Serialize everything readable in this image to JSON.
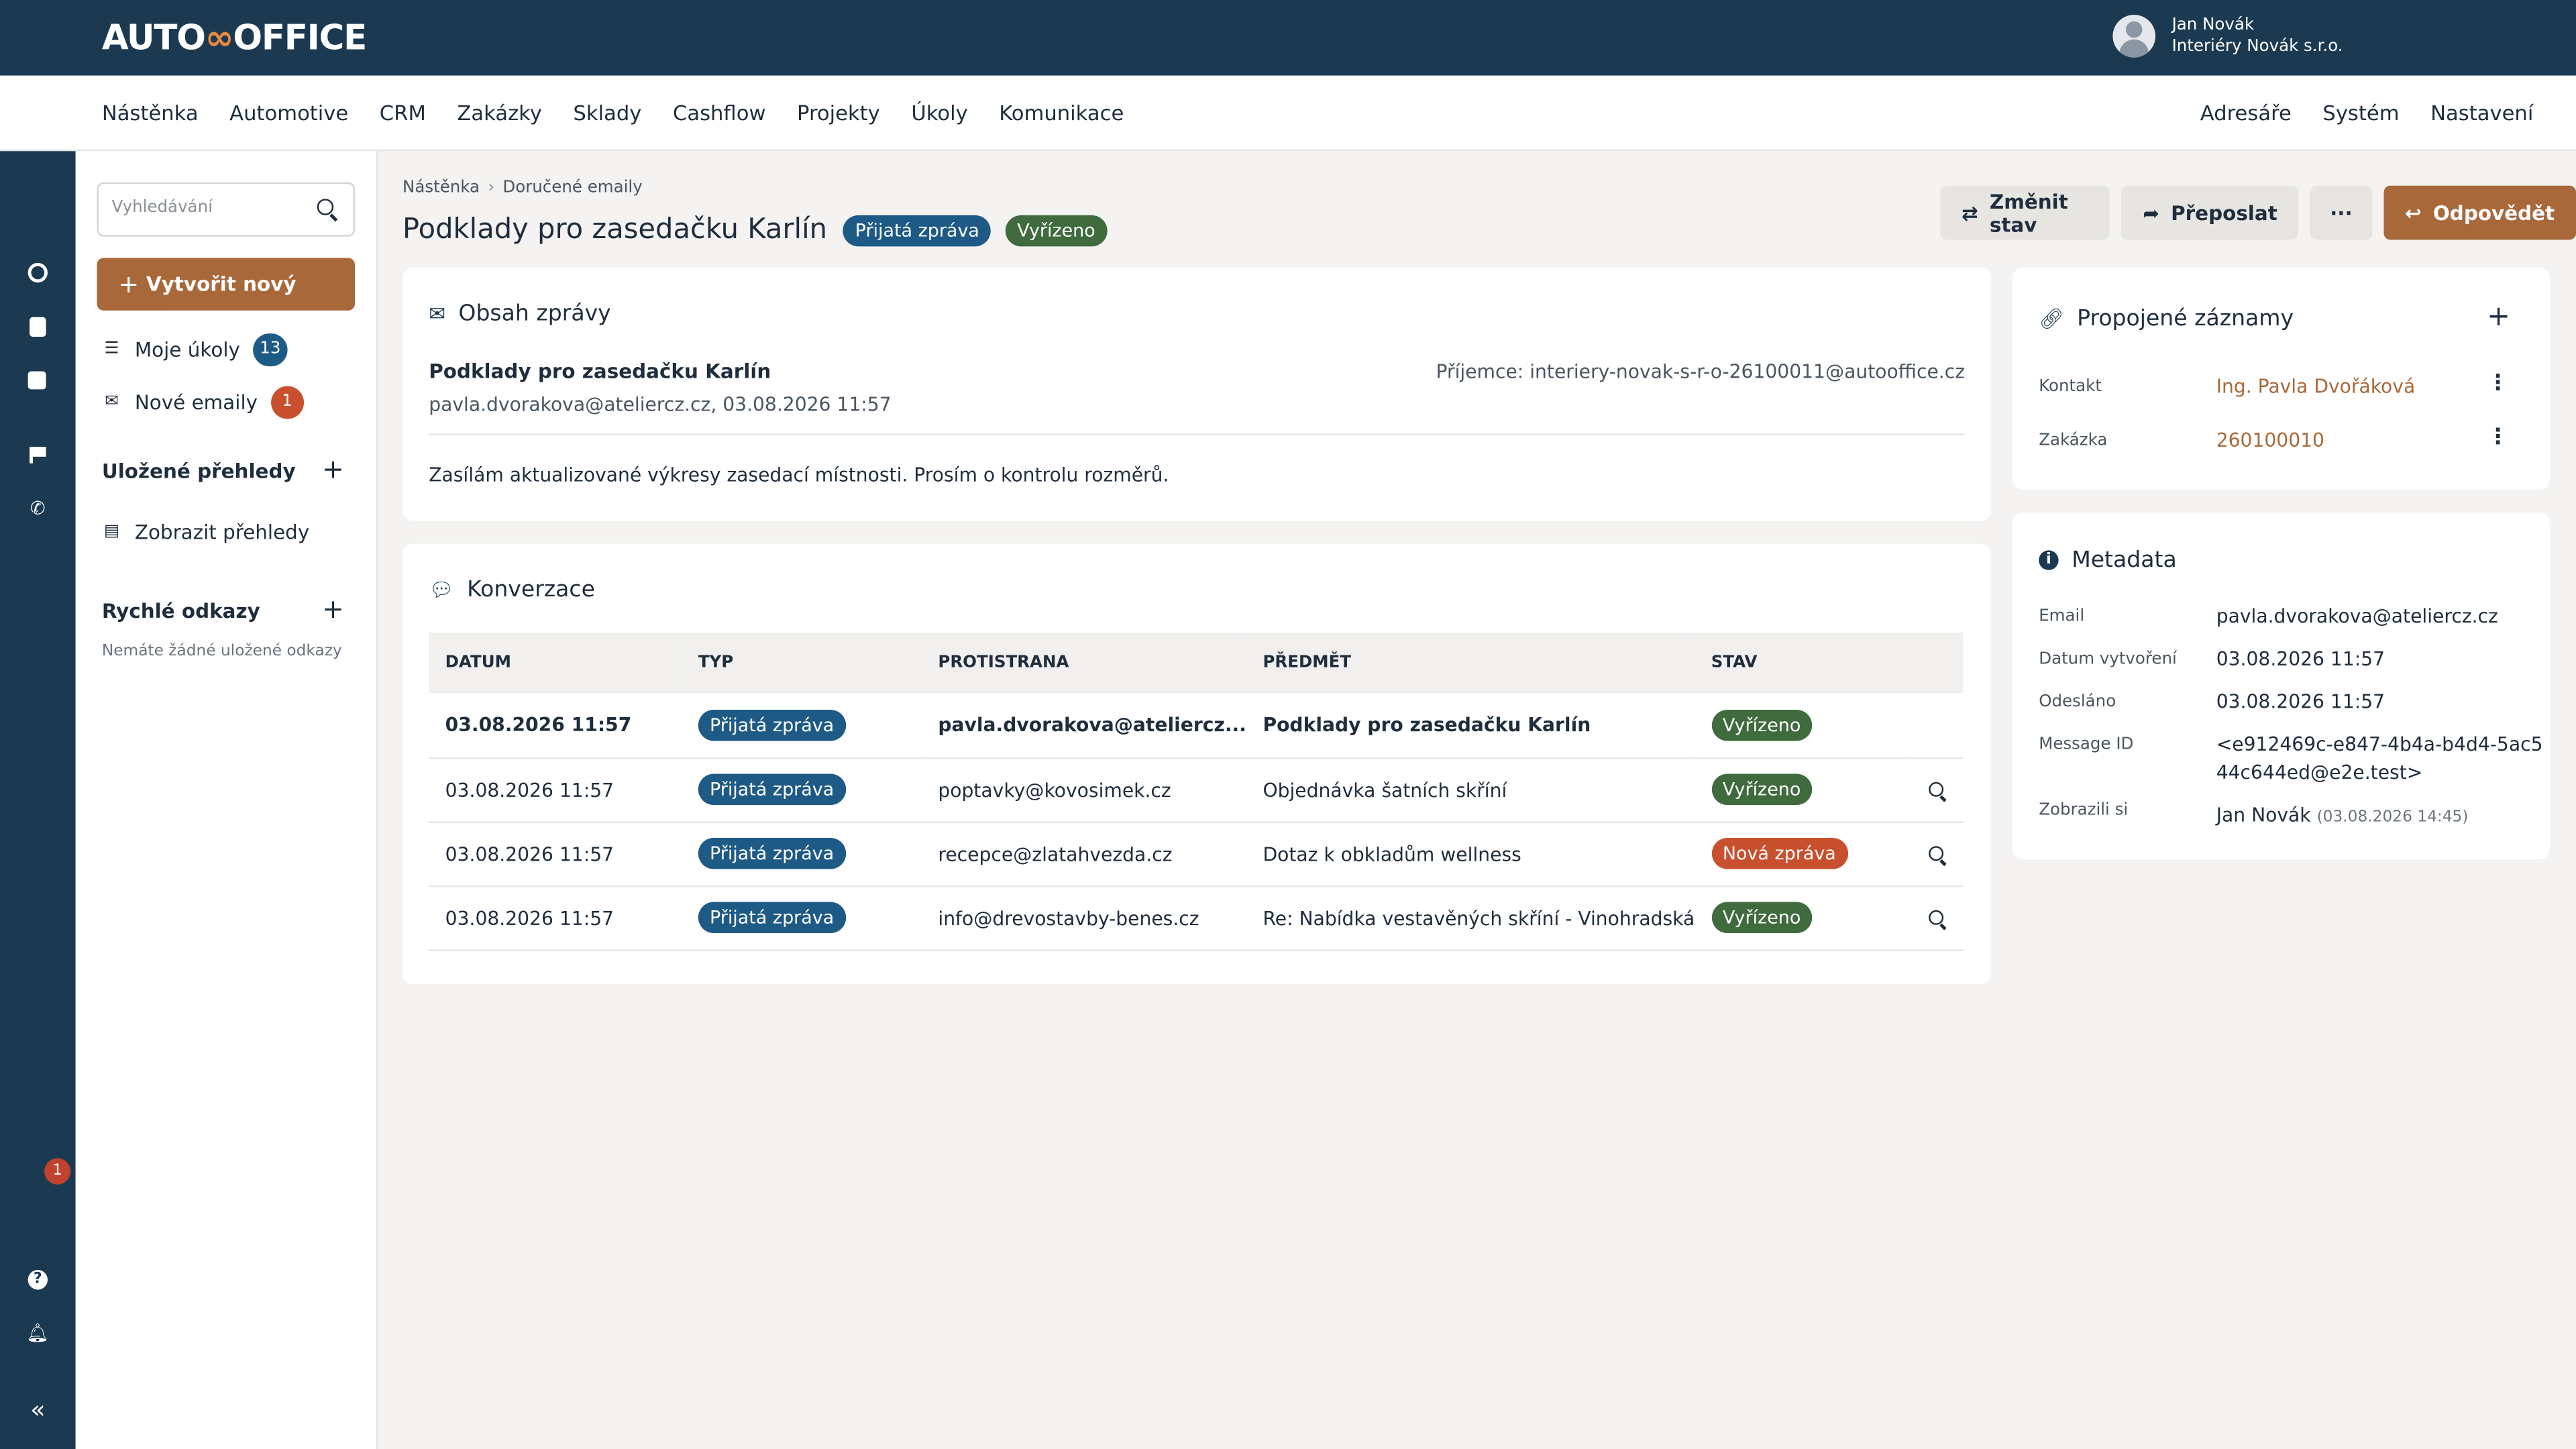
{
  "app": {
    "logo_a": "AUTO",
    "logo_b": "OFFICE",
    "user_name": "Jan Novák",
    "user_company": "Interiéry Novák s.r.o."
  },
  "nav": {
    "left": [
      "Nástěnka",
      "Automotive",
      "CRM",
      "Zakázky",
      "Sklady",
      "Cashflow",
      "Projekty",
      "Úkoly",
      "Komunikace"
    ],
    "right": [
      "Adresáře",
      "Systém",
      "Nastavení"
    ]
  },
  "rail": {
    "icons": [
      "clock-icon",
      "calculator-icon",
      "calendar-icon",
      "flag-icon",
      "phone-icon",
      "help-icon",
      "bell-icon",
      "collapse-icon"
    ],
    "notifications": "1"
  },
  "sidebar": {
    "search_placeholder": "Vyhledávání",
    "create_label": "Vytvořit nový",
    "my_tasks": "Moje úkoly",
    "my_tasks_count": "13",
    "new_emails": "Nové emaily",
    "new_emails_count": "1",
    "saved_views": "Uložené přehledy",
    "show_views": "Zobrazit přehledy",
    "quick_links": "Rychlé odkazy",
    "no_links": "Nemáte žádné uložené odkazy"
  },
  "breadcrumb": [
    "Nástěnka",
    "Doručené emaily"
  ],
  "page": {
    "title": "Podklady pro zasedačku Karlín",
    "type_badge": "Přijatá zpráva",
    "status_badge": "Vyřízeno"
  },
  "actions": {
    "change_status": "Změnit stav",
    "forward": "Přeposlat",
    "more": "···",
    "reply": "Odpovědět"
  },
  "message": {
    "card_title": "Obsah zprávy",
    "subject": "Podklady pro zasedačku Karlín",
    "from_line": "pavla.dvorakova@ateliercz.cz, 03.08.2026 11:57",
    "recipient": "Příjemce: interiery-novak-s-r-o-26100011@autooffice.cz",
    "body": "Zasílám aktualizované výkresy zasedací místnosti. Prosím o kontrolu rozměrů."
  },
  "conversation": {
    "title": "Konverzace",
    "headers": [
      "DATUM",
      "TYP",
      "PROTISTRANA",
      "PŘEDMĚT",
      "STAV"
    ],
    "rows": [
      {
        "date": "03.08.2026 11:57",
        "type": "Přijatá zpráva",
        "party": "pavla.dvorakova@ateliercz...",
        "subject": "Podklady pro zasedačku Karlín",
        "status": "Vyřízeno",
        "status_color": "#3f6b3f"
      },
      {
        "date": "03.08.2026 11:57",
        "type": "Přijatá zpráva",
        "party": "poptavky@kovosimek.cz",
        "subject": "Objednávka šatních skříní",
        "status": "Vyřízeno",
        "status_color": "#3f6b3f"
      },
      {
        "date": "03.08.2026 11:57",
        "type": "Přijatá zpráva",
        "party": "recepce@zlatahvezda.cz",
        "subject": "Dotaz k obkladům wellness",
        "status": "Nová zpráva",
        "status_color": "#c8502e"
      },
      {
        "date": "03.08.2026 11:57",
        "type": "Přijatá zpráva",
        "party": "info@drevostavby-benes.cz",
        "subject": "Re: Nabídka vestavěných skříní - Vinohradská",
        "status": "Vyřízeno",
        "status_color": "#3f6b3f"
      }
    ]
  },
  "linked": {
    "title": "Propojené záznamy",
    "contact_label": "Kontakt",
    "contact_value": "Ing. Pavla Dvořáková",
    "order_label": "Zakázka",
    "order_value": "260100010"
  },
  "metadata": {
    "title": "Metadata",
    "email_label": "Email",
    "email_value": "pavla.dvorakova@ateliercz.cz",
    "created_label": "Datum vytvoření",
    "created_value": "03.08.2026 11:57",
    "sent_label": "Odesláno",
    "sent_value": "03.08.2026 11:57",
    "msgid_label": "Message ID",
    "msgid_line1": "<e912469c-e847-4b4a-b4d4-5ac5",
    "msgid_line2": "44c644ed@e2e.test>",
    "viewed_label": "Zobrazili si",
    "viewed_name": "Jan Novák",
    "viewed_time": "(03.08.2026 14:45)"
  },
  "colors": {
    "brand_dark": "#1b3a52",
    "accent": "#a8683a",
    "badge_blue": "#1e5a86",
    "badge_green": "#3f6b3f",
    "badge_red": "#c8502e"
  }
}
